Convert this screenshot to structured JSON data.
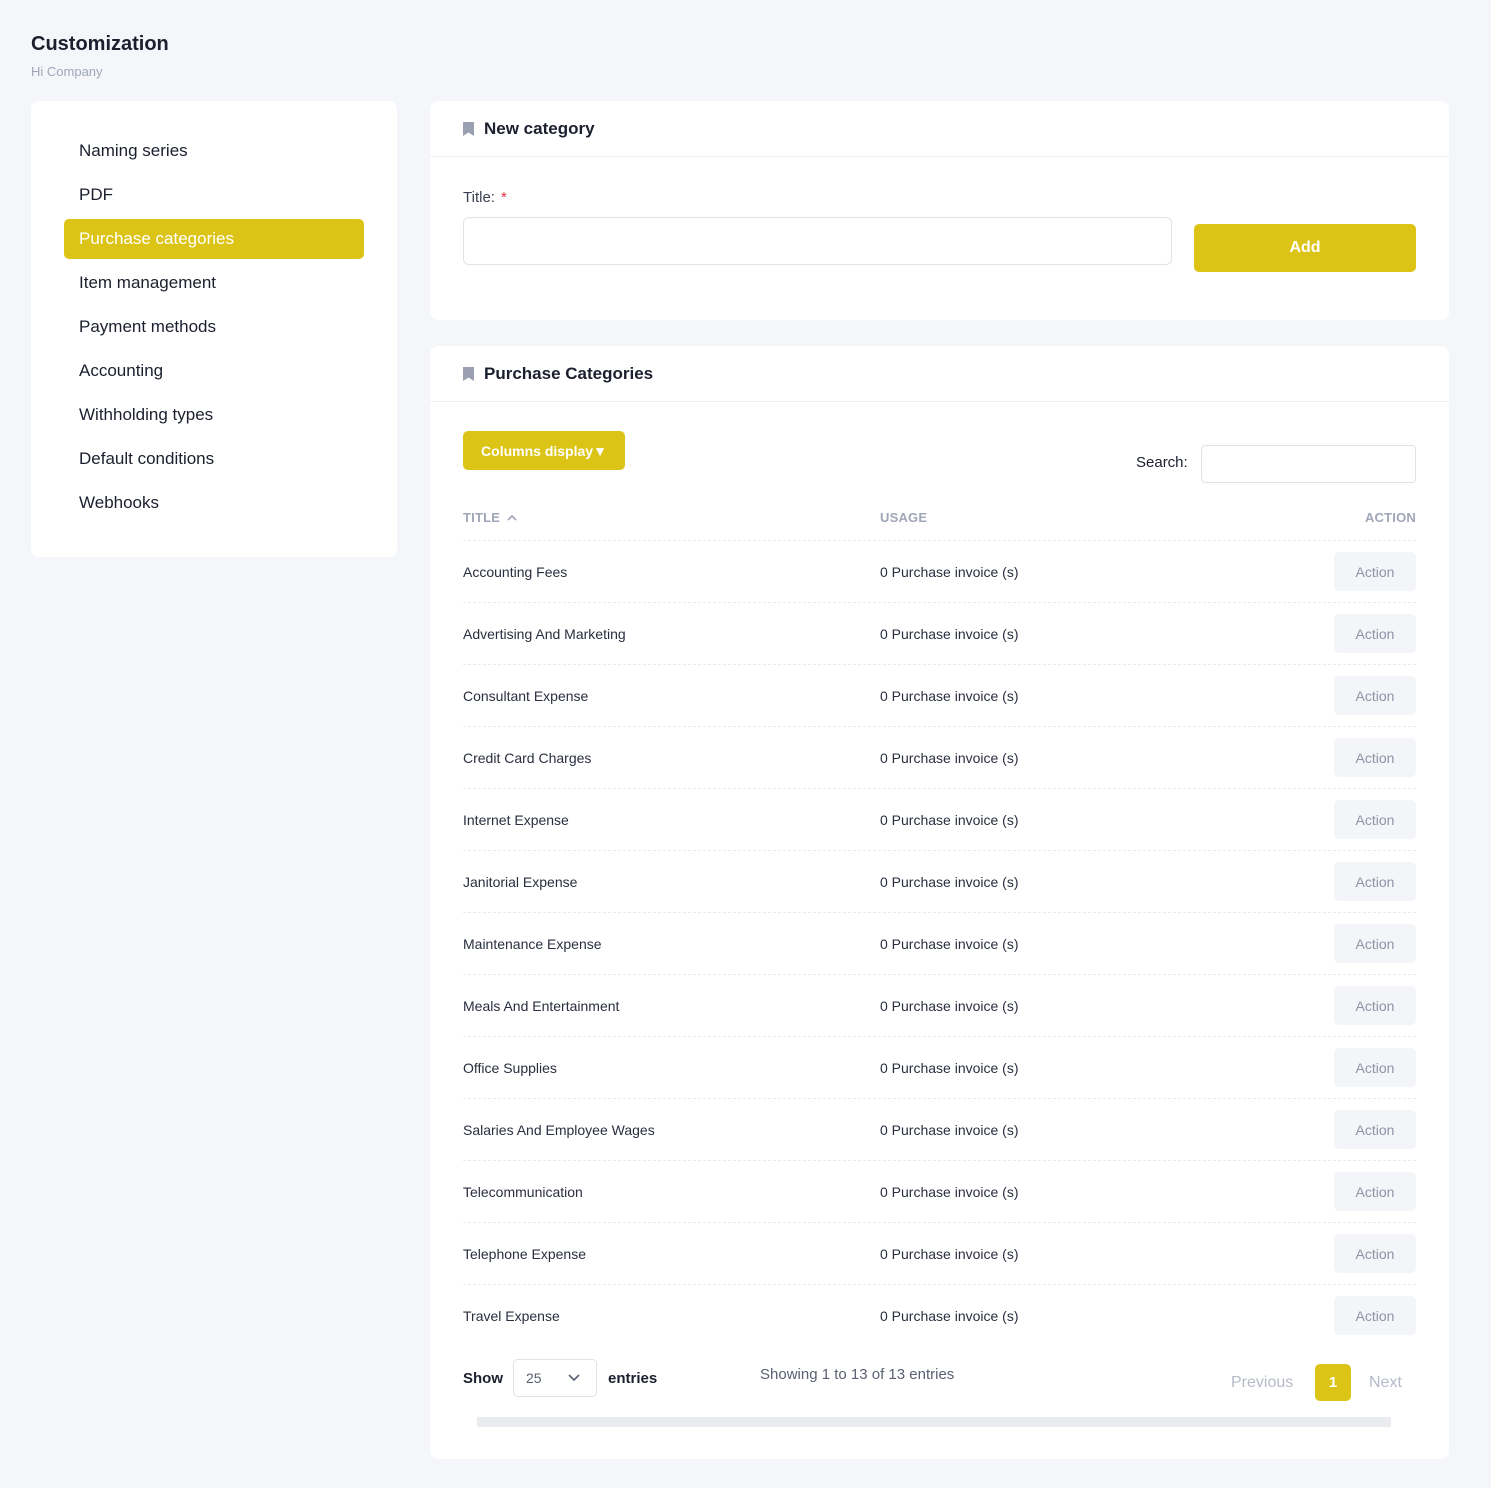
{
  "header": {
    "title": "Customization",
    "subtitle": "Hi Company"
  },
  "sidebar": {
    "items": [
      {
        "label": "Naming series"
      },
      {
        "label": "PDF"
      },
      {
        "label": "Purchase categories"
      },
      {
        "label": "Item management"
      },
      {
        "label": "Payment methods"
      },
      {
        "label": "Accounting"
      },
      {
        "label": "Withholding types"
      },
      {
        "label": "Default conditions"
      },
      {
        "label": "Webhooks"
      }
    ],
    "active_index": 2
  },
  "new_category": {
    "heading": "New category",
    "title_label": "Title:",
    "required_mark": "*",
    "title_value": "",
    "add_label": "Add"
  },
  "categories": {
    "heading": "Purchase Categories",
    "columns_button": "Columns display▼",
    "search_label": "Search:",
    "search_value": "",
    "columns": {
      "title": "TITLE",
      "usage": "USAGE",
      "action": "ACTION"
    },
    "rows": [
      {
        "title": "Accounting Fees",
        "usage": "0 Purchase invoice (s)",
        "action": "Action"
      },
      {
        "title": "Advertising And Marketing",
        "usage": "0 Purchase invoice (s)",
        "action": "Action"
      },
      {
        "title": "Consultant Expense",
        "usage": "0 Purchase invoice (s)",
        "action": "Action"
      },
      {
        "title": "Credit Card Charges",
        "usage": "0 Purchase invoice (s)",
        "action": "Action"
      },
      {
        "title": "Internet Expense",
        "usage": "0 Purchase invoice (s)",
        "action": "Action"
      },
      {
        "title": "Janitorial Expense",
        "usage": "0 Purchase invoice (s)",
        "action": "Action"
      },
      {
        "title": "Maintenance Expense",
        "usage": "0 Purchase invoice (s)",
        "action": "Action"
      },
      {
        "title": "Meals And Entertainment",
        "usage": "0 Purchase invoice (s)",
        "action": "Action"
      },
      {
        "title": "Office Supplies",
        "usage": "0 Purchase invoice (s)",
        "action": "Action"
      },
      {
        "title": "Salaries And Employee Wages",
        "usage": "0 Purchase invoice (s)",
        "action": "Action"
      },
      {
        "title": "Telecommunication",
        "usage": "0 Purchase invoice (s)",
        "action": "Action"
      },
      {
        "title": "Telephone Expense",
        "usage": "0 Purchase invoice (s)",
        "action": "Action"
      },
      {
        "title": "Travel Expense",
        "usage": "0 Purchase invoice (s)",
        "action": "Action"
      }
    ],
    "footer": {
      "show_label": "Show",
      "page_length": "25",
      "entries_label": "entries",
      "info": "Showing 1 to 13 of 13 entries",
      "previous": "Previous",
      "current_page": "1",
      "next": "Next"
    }
  },
  "colors": {
    "accent": "#dcc417",
    "background": "#f4f6f9"
  }
}
